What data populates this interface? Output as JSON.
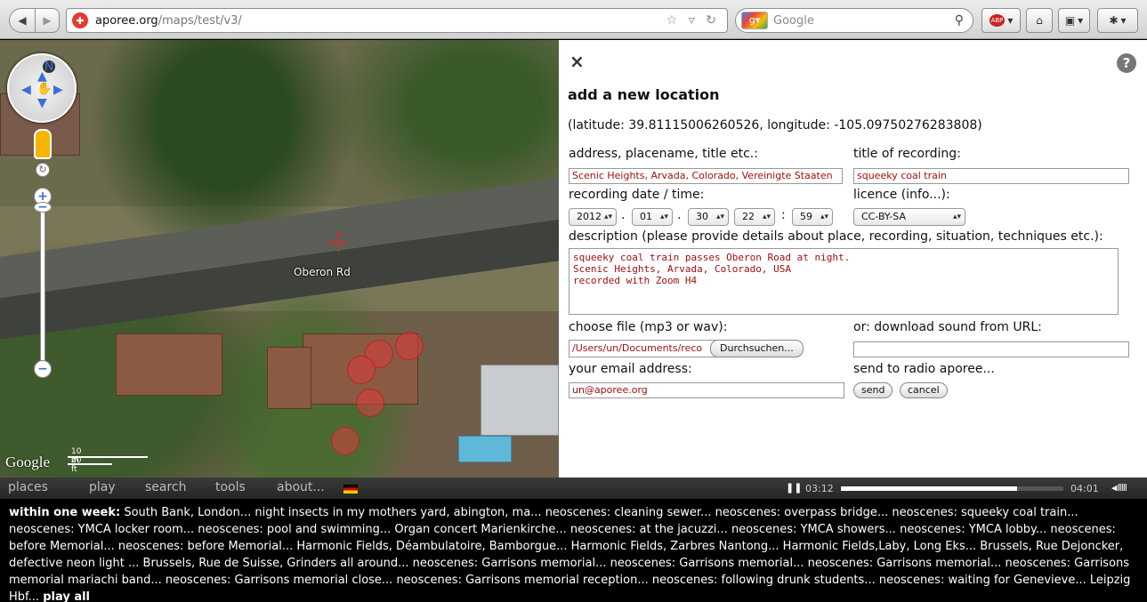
{
  "browser": {
    "url_host": "aporee.org",
    "url_path": "/maps/test/v3/",
    "search_placeholder": "Google",
    "abp_label": "ABP"
  },
  "map": {
    "road_label": "Oberon Rd",
    "google_logo": "Google",
    "scale_top": "10 m",
    "scale_bottom": "20 ft",
    "compass_label": "N"
  },
  "dialog": {
    "close": "×",
    "help": "?",
    "title": "add a new location",
    "coords": "(latitude: 39.81115006260526, longitude: -105.09750276283808)",
    "address_label": "address, placename, title etc.:",
    "address_value": "Scenic Heights, Arvada, Colorado, Vereinigte Staaten",
    "rec_title_label": "title of recording:",
    "rec_title_value": "squeeky coal train",
    "date_label": "recording date / time:",
    "year": "2012",
    "month": "01",
    "day": "30",
    "hour": "22",
    "minute": "59",
    "date_sep": ".",
    "time_sep": ":",
    "licence_label": "licence (info...):",
    "licence_value": "CC-BY-SA",
    "desc_label": "description (please provide details about place, recording, situation, techniques etc.):",
    "desc_value": "squeeky coal train passes Oberon Road at night.\nScenic Heights, Arvada, Colorado, USA\nrecorded with Zoom H4",
    "file_label": "choose file (mp3 or wav):",
    "file_value": "/Users/un/Documents/reco",
    "browse_button": "Durchsuchen...",
    "url_label": "or: download sound from URL:",
    "url_value": "",
    "email_label": "your email address:",
    "email_value": "un@aporee.org",
    "radio_label": "send to radio aporee...",
    "send_button": "send",
    "cancel_button": "cancel"
  },
  "nav": {
    "items": [
      "places",
      "play",
      "search",
      "tools",
      "about..."
    ]
  },
  "player": {
    "current": "03:12",
    "total": "04:01",
    "progress": 0.79
  },
  "feed": {
    "heading": "within one week:",
    "text": " South Bank, London... night insects in my mothers yard, abington, ma... neoscenes: cleaning sewer... neoscenes: overpass bridge... neoscenes: squeeky coal train... neoscenes: YMCA locker room... neoscenes: pool and swimming... Organ concert Marienkirche... neoscenes: at the jacuzzi... neoscenes: YMCA showers... neoscenes: YMCA lobby... neoscenes: before Memorial... neoscenes: before Memorial... Harmonic Fields, Déambulatoire, Bamborgue... Harmonic Fields, Zarbres Nantong... Harmonic Fields,Laby, Long Eks... Brussels, Rue Dejoncker, defective neon light ... Brussels, Rue de Suisse, Grinders all around... neoscenes: Garrisons memorial... neoscenes: Garrisons memorial... neoscenes: Garrisons memorial... neoscenes: Garrisons memorial mariachi band... neoscenes: Garrisons memorial close... neoscenes: Garrisons memorial reception... neoscenes: following drunk students... neoscenes: waiting for Genevieve... Leipzig Hbf... ",
    "play_all": "play all"
  }
}
